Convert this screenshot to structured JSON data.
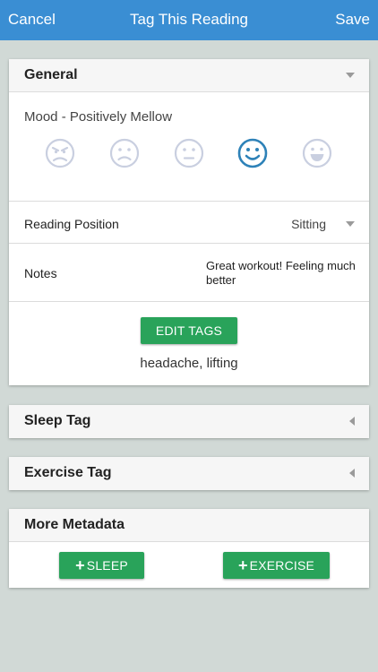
{
  "navbar": {
    "cancel": "Cancel",
    "title": "Tag This Reading",
    "save": "Save"
  },
  "general": {
    "header": "General",
    "mood_label": "Mood - Positively Mellow",
    "moods": [
      {
        "name": "angry",
        "selected": false
      },
      {
        "name": "sad",
        "selected": false
      },
      {
        "name": "neutral",
        "selected": false
      },
      {
        "name": "happy",
        "selected": true
      },
      {
        "name": "very-happy",
        "selected": false
      }
    ],
    "reading_position_label": "Reading Position",
    "reading_position_value": "Sitting",
    "notes_label": "Notes",
    "notes_value": "Great workout! Feeling much better",
    "edit_tags_button": "EDIT TAGS",
    "tags_value": "headache, lifting"
  },
  "sleep_tag": {
    "header": "Sleep Tag"
  },
  "exercise_tag": {
    "header": "Exercise Tag"
  },
  "more_metadata": {
    "header": "More Metadata",
    "sleep_button": "SLEEP",
    "exercise_button": "EXERCISE"
  },
  "colors": {
    "navbar": "#3a8ed3",
    "background": "#d1d9d6",
    "button_green": "#29a35a",
    "mood_selected": "#2e82b8",
    "mood_unselected": "#c9cfe0"
  }
}
